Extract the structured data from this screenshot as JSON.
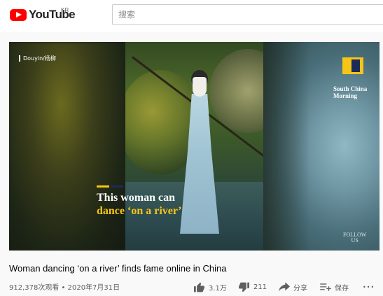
{
  "header": {
    "logo_text": "YouTube",
    "region": "KR",
    "search_placeholder": "搜索"
  },
  "video": {
    "source_badge": "Douyin/杨柳",
    "caption_line1": "This woman can",
    "caption_line2": "dance ‘on a river’",
    "publisher": "South China Morning",
    "follow_line1": "FOLLOW",
    "follow_line2": "US",
    "accent_yellow": "#f5c518",
    "accent_navy": "#1d2a5a"
  },
  "info": {
    "title": "Woman dancing ‘on a river’ finds fame online in China",
    "meta": "912,378次观看 • 2020年7月31日"
  },
  "actions": {
    "like_count": "3.1万",
    "dislike_count": "211",
    "share_label": "分享",
    "save_label": "保存",
    "more_label": "•••"
  }
}
